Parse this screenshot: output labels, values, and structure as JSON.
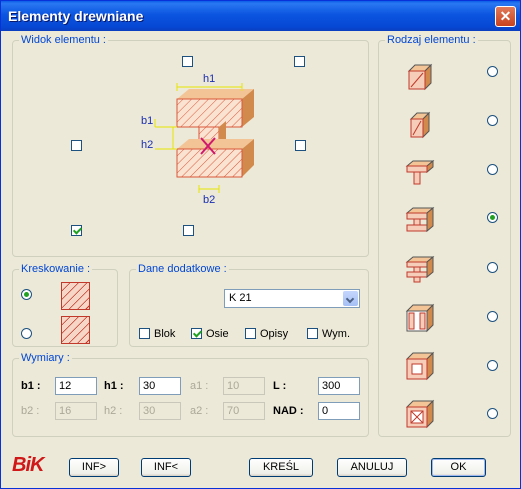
{
  "window": {
    "title": "Elementy drewniane",
    "close": "✕"
  },
  "widok": {
    "label": "Widok elementu :",
    "dims": {
      "h1": "h1",
      "b1": "b1",
      "h2": "h2",
      "b2": "b2"
    }
  },
  "rodzaj": {
    "label": "Rodzaj elementu :",
    "selected_index": 3
  },
  "kreskowanie": {
    "label": "Kreskowanie :"
  },
  "dane": {
    "label": "Dane dodatkowe :",
    "select_value": "K 21",
    "checks": [
      {
        "label": "Blok",
        "checked": false
      },
      {
        "label": "Osie",
        "checked": true
      },
      {
        "label": "Opisy",
        "checked": false
      },
      {
        "label": "Wym.",
        "checked": false
      }
    ]
  },
  "wymiary": {
    "label": "Wymiary :",
    "b1_label": "b1 :",
    "b1": "12",
    "h1_label": "h1 :",
    "h1": "30",
    "a1_label": "a1 :",
    "a1": "10",
    "L_label": "L :",
    "L": "300",
    "b2_label": "b2 :",
    "b2": "16",
    "h2_label": "h2 :",
    "h2": "30",
    "a2_label": "a2 :",
    "a2": "70",
    "NAD_label": "NAD :",
    "NAD": "0"
  },
  "footer": {
    "logo": "BiK",
    "buttons": {
      "inf1": "INF>",
      "inf2": "INF<",
      "kresl": "KREŚL",
      "anuluj": "ANULUJ",
      "ok": "OK"
    }
  }
}
